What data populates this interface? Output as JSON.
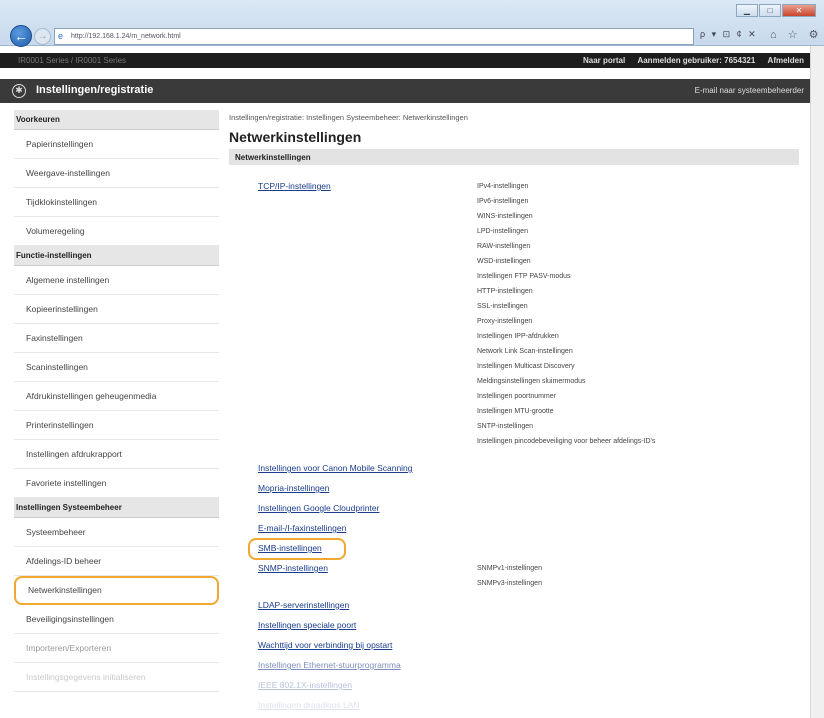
{
  "browser": {
    "url": "http://192.168.1.24/m_network.html",
    "address_tools": "ρ ▾ ⊡ ¢ ✕",
    "home_icons": "⌂ ☆ ⚙",
    "win_min": "▁",
    "win_max": "□",
    "win_close": "✕"
  },
  "header": {
    "device": "IR0001 Series / IR0001 Series",
    "portal": "Naar portal",
    "user_label": "Aanmelden gebruiker:",
    "user_id": "7654321",
    "logout": "Afmelden",
    "app_title": "Instellingen/registratie",
    "mail_admin": "E-mail naar systeembeheerder"
  },
  "sidebar": {
    "sec1": "Voorkeuren",
    "items1": [
      "Papierinstellingen",
      "Weergave-instellingen",
      "Tijdklokinstellingen",
      "Volumeregeling"
    ],
    "sec2": "Functie-instellingen",
    "items2": [
      "Algemene instellingen",
      "Kopieerinstellingen",
      "Faxinstellingen",
      "Scaninstellingen",
      "Afdrukinstellingen geheugenmedia",
      "Printerinstellingen",
      "Instellingen afdrukrapport",
      "Favoriete instellingen"
    ],
    "sec3": "Instellingen Systeembeheer",
    "items3": [
      "Systeembeheer",
      "Afdelings-ID beheer",
      "Netwerkinstellingen",
      "Beveiligingsinstellingen",
      "Importeren/Exporteren",
      "Instellingsgegevens initialiseren"
    ]
  },
  "main": {
    "breadcrumb": "Instellingen/registratie: Instellingen Systeembeheer: Netwerkinstellingen",
    "title": "Netwerkinstellingen",
    "section": "Netwerkinstellingen",
    "tcpip": "TCP/IP-instellingen",
    "tcpip_sub": [
      "IPv4-instellingen",
      "IPv6-instellingen",
      "WINS-instellingen",
      "LPD-instellingen",
      "RAW-instellingen",
      "WSD-instellingen",
      "Instellingen FTP PASV-modus",
      "HTTP-instellingen",
      "SSL-instellingen",
      "Proxy-instellingen",
      "Instellingen IPP-afdrukken",
      "Network Link Scan-instellingen",
      "Instellingen Multicast Discovery",
      "Meldingsinstellingen sluimermodus",
      "Instellingen poortnummer",
      "Instellingen MTU-grootte",
      "SNTP-instellingen",
      "Instellingen pincodebeveiliging voor beheer afdelings-ID's"
    ],
    "links": [
      "Instellingen voor Canon Mobile Scanning",
      "Mopria-instellingen",
      "Instellingen Google Cloudprinter",
      "E-mail-/I-faxinstellingen",
      "SMB-instellingen",
      "SNMP-instellingen"
    ],
    "snmp_sub": [
      "SNMPv1-instellingen",
      "SNMPv3-instellingen"
    ],
    "links2": [
      "LDAP-serverinstellingen",
      "Instellingen speciale poort",
      "Wachttijd voor verbinding bij opstart",
      "Instellingen Ethernet-stuurprogramma",
      "IEEE 802.1X-instellingen",
      "Instellingen draadloos LAN"
    ]
  }
}
